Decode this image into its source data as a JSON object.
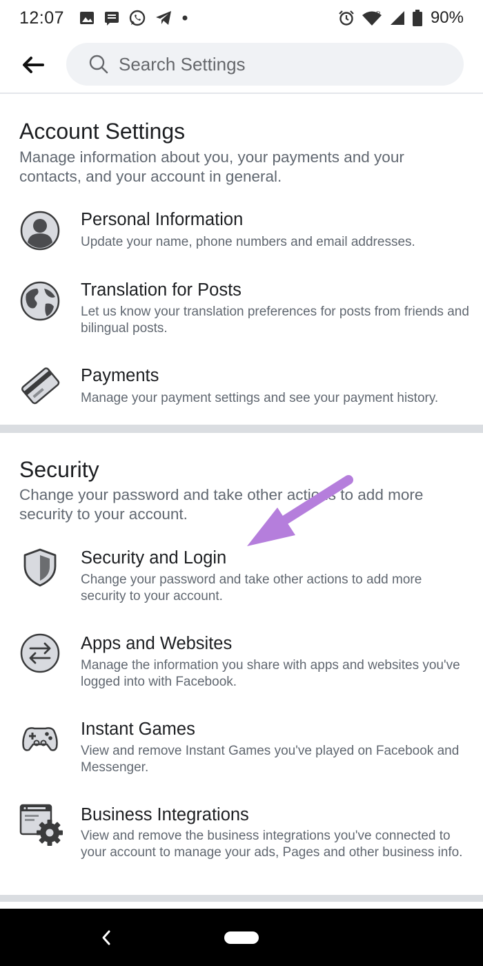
{
  "status_bar": {
    "time": "12:07",
    "battery": "90%"
  },
  "header": {
    "search_placeholder": "Search Settings"
  },
  "account_settings": {
    "title": "Account Settings",
    "description": "Manage information about you, your payments and your contacts, and your account in general.",
    "items": [
      {
        "title": "Personal Information",
        "description": "Update your name, phone numbers and email addresses.",
        "icon": "person-icon"
      },
      {
        "title": "Translation for Posts",
        "description": "Let us know your translation preferences for posts from friends and bilingual posts.",
        "icon": "globe-icon"
      },
      {
        "title": "Payments",
        "description": "Manage your payment settings and see your payment history.",
        "icon": "credit-card-icon"
      }
    ]
  },
  "security": {
    "title": "Security",
    "description": "Change your password and take other actions to add more security to your account.",
    "items": [
      {
        "title": "Security and Login",
        "description": "Change your password and take other actions to add more security to your account.",
        "icon": "shield-icon"
      },
      {
        "title": "Apps and Websites",
        "description": "Manage the information you share with apps and websites you've logged into with Facebook.",
        "icon": "swap-arrows-icon"
      },
      {
        "title": "Instant Games",
        "description": "View and remove Instant Games you've played on Facebook and Messenger.",
        "icon": "gamepad-icon"
      },
      {
        "title": "Business Integrations",
        "description": "View and remove the business integrations you've connected to your account to manage your ads, Pages and other business info.",
        "icon": "browser-gear-icon"
      }
    ]
  },
  "colors": {
    "annotation_arrow": "#b57edc",
    "icon_fill": "#d8dadf",
    "icon_stroke": "#3a3b3c",
    "divider": "#dadde1"
  }
}
